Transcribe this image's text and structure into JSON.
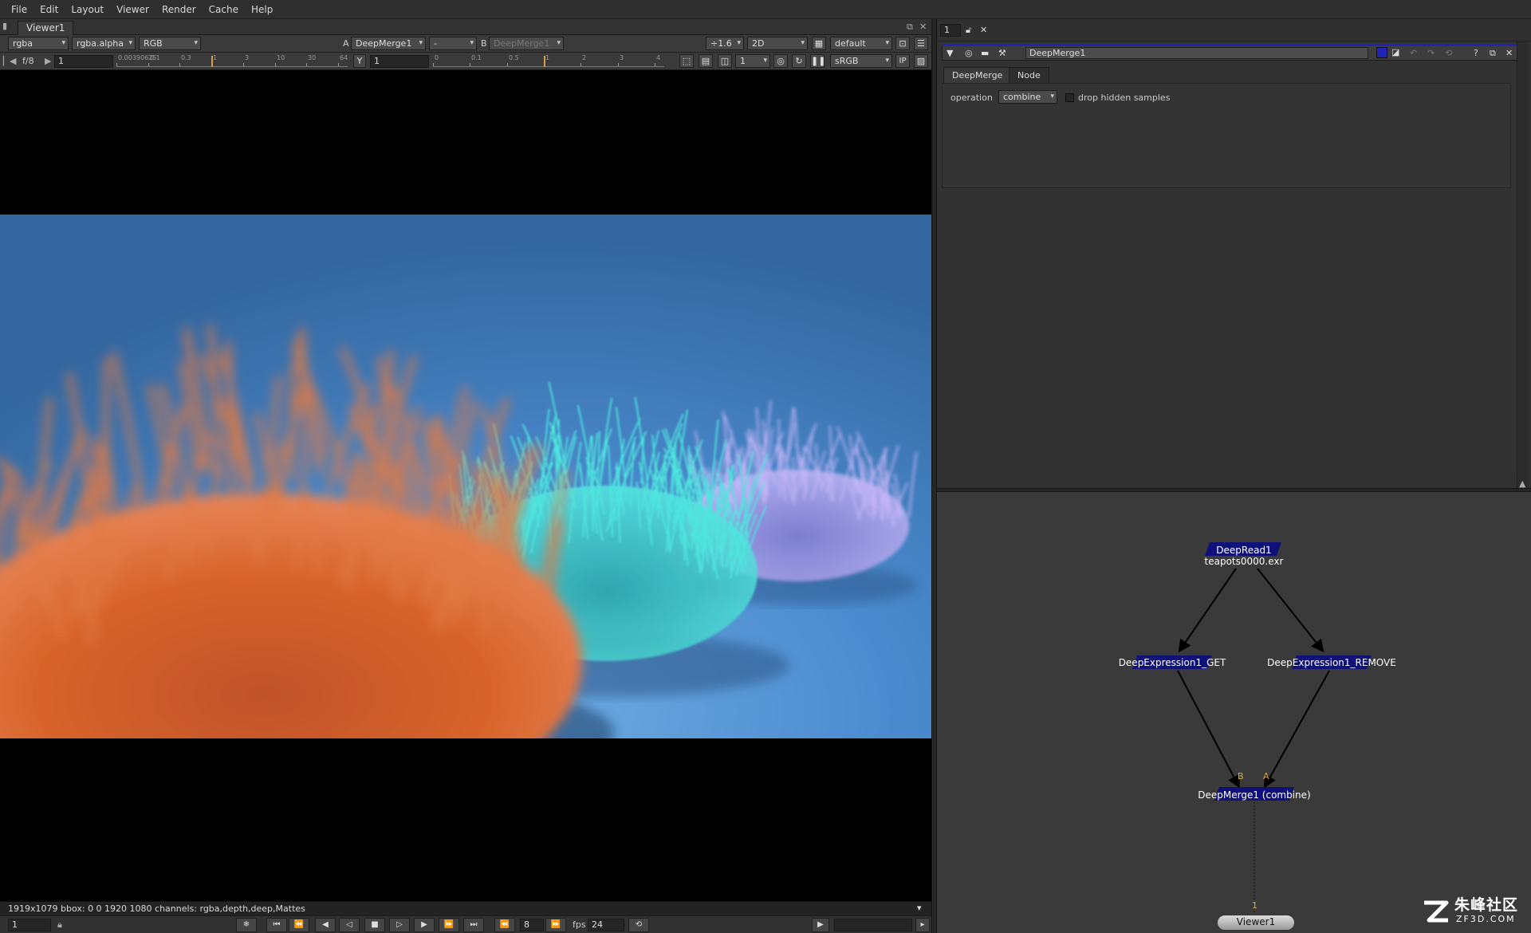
{
  "menu": [
    "File",
    "Edit",
    "Layout",
    "Viewer",
    "Render",
    "Cache",
    "Help"
  ],
  "viewer": {
    "tab": "Viewer1",
    "channels": "rgba",
    "alpha_channel": "rgba.alpha",
    "display_channels": "RGB",
    "input_a_label": "A",
    "input_a": "DeepMerge1",
    "wipe_op": "-",
    "input_b_label": "B",
    "input_b": "DeepMerge1",
    "zoom": "÷1.6",
    "view_mode": "2D",
    "lut_default": "default",
    "fstop": "f/8",
    "gain": "1",
    "gain_ticks": [
      "0.00390625",
      "0.1",
      "0.3",
      "1",
      "3",
      "10",
      "30",
      "64"
    ],
    "gamma_label": "Y",
    "gamma": "1",
    "gamma_ticks": [
      "0",
      "0.1",
      "0.5",
      "1",
      "2",
      "3",
      "4"
    ],
    "proxy": "1",
    "colorspace": "sRGB",
    "ip_label": "IP",
    "info": "1919x1079 bbox: 0 0 1920 1080 channels: rgba,depth,deep,Mattes",
    "frame": "1",
    "increment": "8",
    "fps_label": "fps",
    "fps": "24"
  },
  "properties": {
    "bin_count": "1",
    "node_name": "DeepMerge1",
    "tabs": [
      "DeepMerge",
      "Node"
    ],
    "operation_label": "operation",
    "operation_value": "combine",
    "drop_hidden_label": "drop hidden samples",
    "drop_hidden_checked": false
  },
  "graph": {
    "nodes": [
      {
        "id": "deepread",
        "label": "DeepRead1",
        "sub": "teapots0000.exr"
      },
      {
        "id": "get",
        "label": "DeepExpression1_GET"
      },
      {
        "id": "remove",
        "label": "DeepExpression1_REMOVE"
      },
      {
        "id": "merge",
        "label": "DeepMerge1 (combine)"
      },
      {
        "id": "viewer",
        "label": "Viewer1"
      }
    ],
    "pin_b": "B",
    "pin_a": "A",
    "pin_viewer": "1"
  },
  "watermark": {
    "cn": "朱峰社区",
    "en": "ZF3D.COM"
  },
  "colors": {
    "node_blue": "#10107a",
    "accent_blue": "#2323b5",
    "pin_orange": "#e2b04a",
    "fur_orange": "#d8642a",
    "fur_cyan": "#45e0d8",
    "fur_lilac": "#b8a8f0"
  }
}
